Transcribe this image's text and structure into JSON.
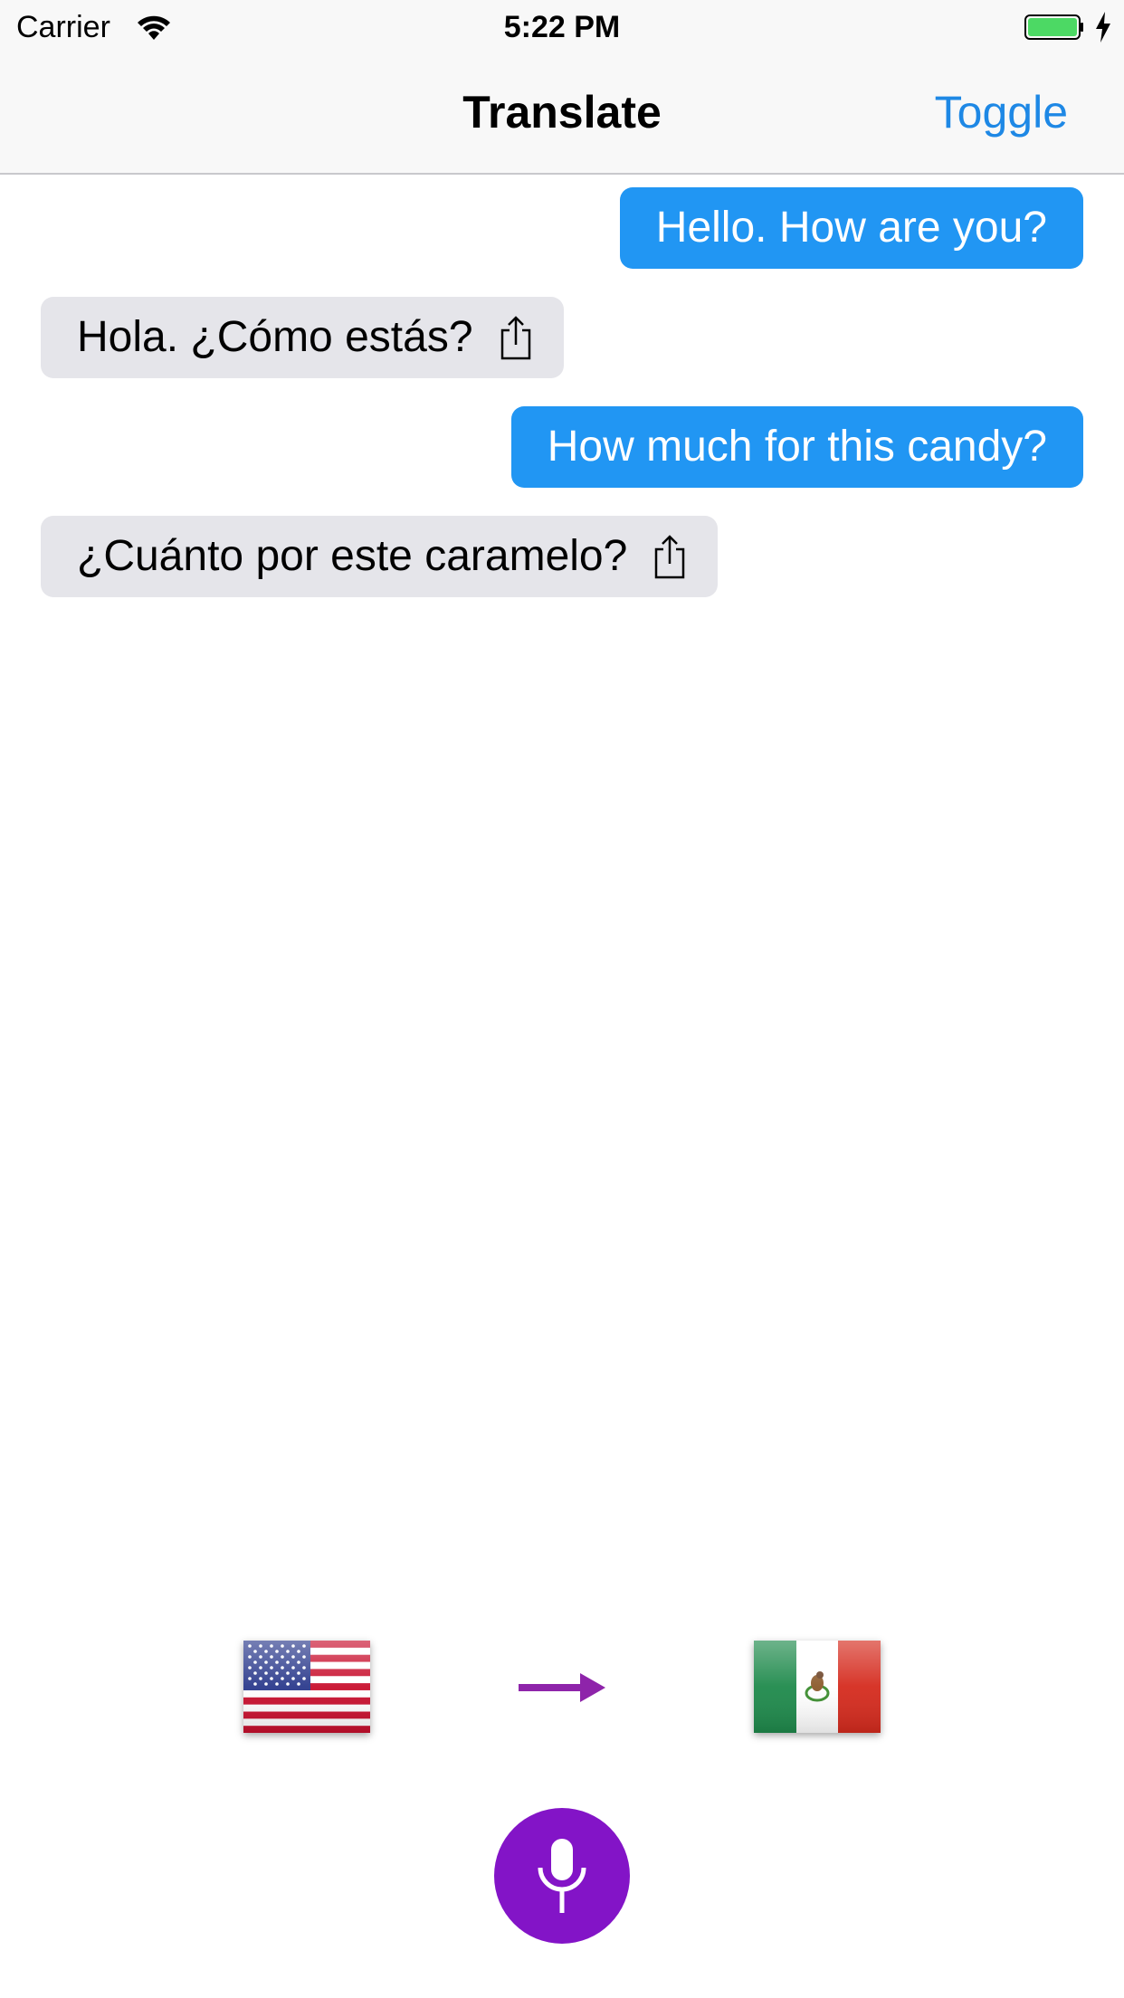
{
  "status_bar": {
    "carrier": "Carrier",
    "time": "5:22 PM",
    "wifi_icon": "wifi-icon",
    "battery_icon": "battery-charging-icon",
    "battery_color": "#4cd964"
  },
  "nav_bar": {
    "title": "Translate",
    "toggle_label": "Toggle"
  },
  "colors": {
    "accent": "#1e88e5",
    "outgoing_bubble": "#2196f3",
    "incoming_bubble": "#e5e5ea",
    "mic_button": "#8314c7",
    "arrow": "#8e24aa"
  },
  "messages": [
    {
      "direction": "outgoing",
      "text": "Hello. How are you?"
    },
    {
      "direction": "incoming",
      "text": "Hola. ¿Cómo estás?",
      "icon": "share-icon"
    },
    {
      "direction": "outgoing",
      "text": "How much for this candy?"
    },
    {
      "direction": "incoming",
      "text": "¿Cuánto por este caramelo?",
      "icon": "share-icon"
    }
  ],
  "languages": {
    "source_flag": "us-flag-icon",
    "target_flag": "mexico-flag-icon",
    "direction_icon": "arrow-right-icon"
  },
  "mic_button": {
    "icon": "microphone-icon"
  }
}
